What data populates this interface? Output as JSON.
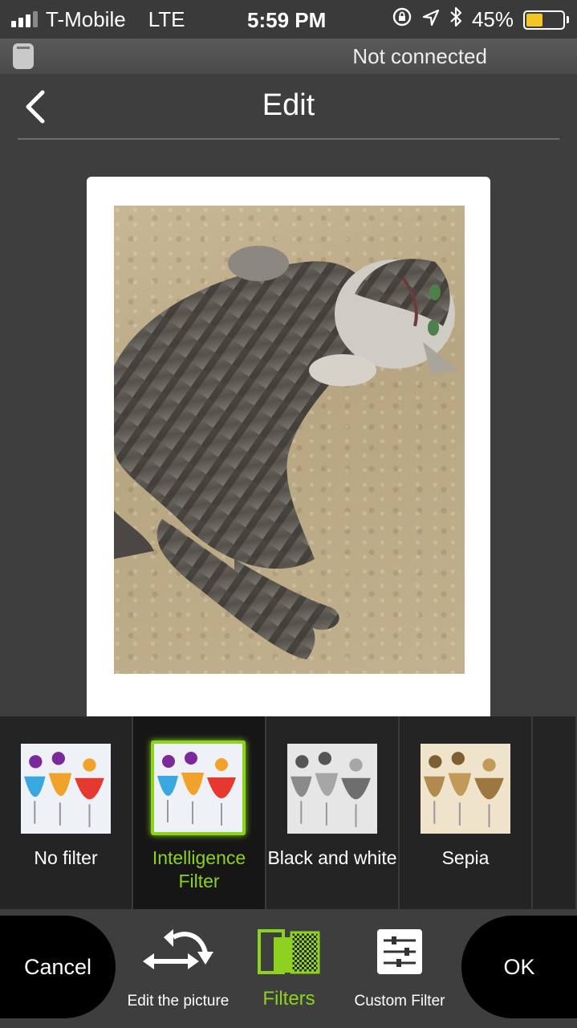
{
  "status_bar": {
    "carrier": "T-Mobile",
    "network": "LTE",
    "time": "5:59 PM",
    "battery_percent": "45%",
    "battery_level": 0.45,
    "icons": [
      "signal-icon",
      "rotation-lock-icon",
      "location-icon",
      "bluetooth-icon",
      "battery-icon"
    ]
  },
  "connection": {
    "status": "Not connected"
  },
  "header": {
    "title": "Edit"
  },
  "filters": [
    {
      "label": "No filter",
      "selected": false,
      "style": "color"
    },
    {
      "label": "Intelligence Filter",
      "selected": true,
      "style": "color"
    },
    {
      "label": "Black and white",
      "selected": false,
      "style": "bw"
    },
    {
      "label": "Sepia",
      "selected": false,
      "style": "sepia"
    }
  ],
  "toolbar": {
    "cancel": "Cancel",
    "ok": "OK",
    "edit_picture": "Edit the picture",
    "filters": "Filters",
    "custom_filter": "Custom Filter"
  },
  "colors": {
    "accent": "#8cd21e",
    "background": "#3e3e3e",
    "strip": "#242424",
    "battery": "#f3c623"
  }
}
